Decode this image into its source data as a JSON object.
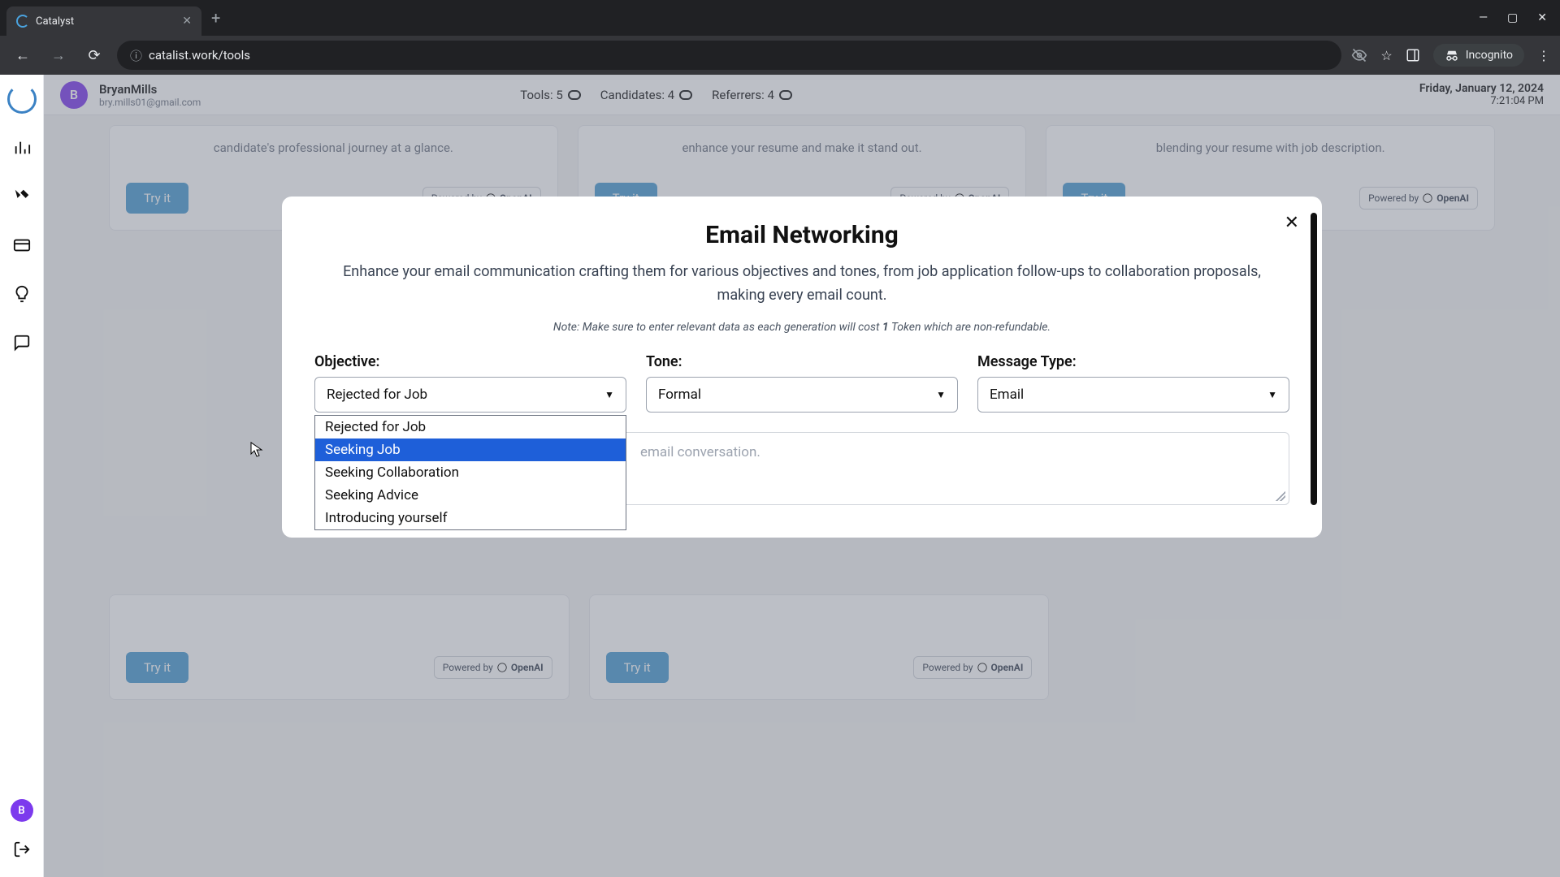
{
  "browser": {
    "tab_title": "Catalyst",
    "url": "catalist.work/tools",
    "incognito_label": "Incognito"
  },
  "topbar": {
    "user_initial": "B",
    "user_name": "BryanMills",
    "user_email": "bry.mills01@gmail.com",
    "stats": {
      "tools_label": "Tools: 5",
      "candidates_label": "Candidates: 4",
      "referrers_label": "Referrers: 4"
    },
    "date": "Friday, January 12, 2024",
    "time": "7:21:04 PM"
  },
  "rail": {
    "avatar_initial": "B"
  },
  "cards": {
    "desc1": "candidate's professional journey at a glance.",
    "desc2": "enhance your resume and make it stand out.",
    "desc3": "blending your resume with job description.",
    "try_label": "Try it",
    "powered_prefix": "Powered by",
    "powered_brand": "OpenAI"
  },
  "modal": {
    "title": "Email Networking",
    "description": "Enhance your email communication crafting them for various objectives and tones, from job application follow-ups to collaboration proposals, making every email count.",
    "note_prefix": "Note: Make sure to enter relevant data as each generation will cost ",
    "note_token": "1",
    "note_suffix": " Token which are non-refundable.",
    "labels": {
      "objective": "Objective:",
      "tone": "Tone:",
      "message_type": "Message Type:"
    },
    "objective": {
      "selected": "Rejected for Job",
      "options": [
        "Rejected for Job",
        "Seeking Job",
        "Seeking Collaboration",
        "Seeking Advice",
        "Introducing yourself"
      ],
      "highlighted_index": 1
    },
    "tone": {
      "selected": "Formal"
    },
    "message_type": {
      "selected": "Email"
    },
    "textarea_placeholder_fragment": "email conversation."
  }
}
